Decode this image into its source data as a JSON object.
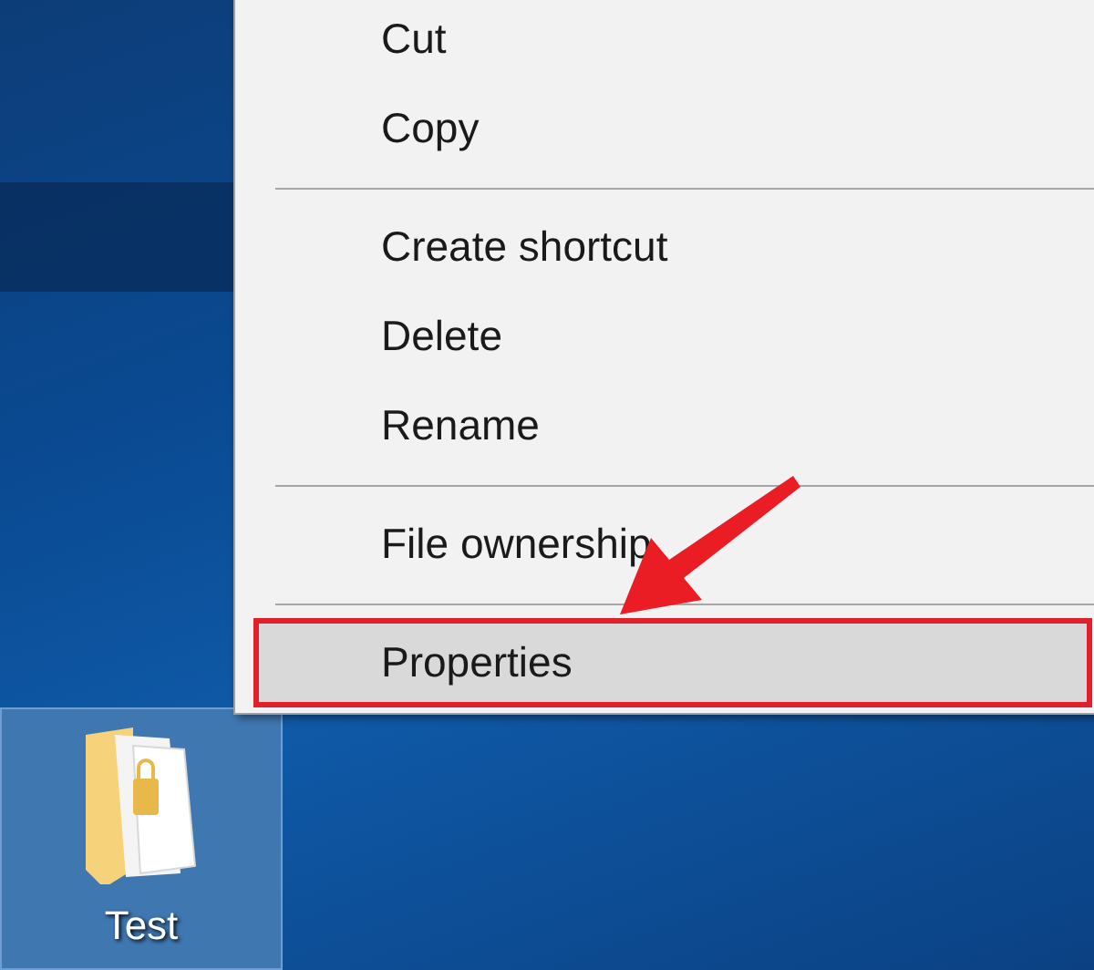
{
  "context_menu": {
    "items": [
      {
        "kind": "item",
        "label": "Cut",
        "selected": false
      },
      {
        "kind": "item",
        "label": "Copy",
        "selected": false
      },
      {
        "kind": "separator"
      },
      {
        "kind": "item",
        "label": "Create shortcut",
        "selected": false
      },
      {
        "kind": "item",
        "label": "Delete",
        "selected": false
      },
      {
        "kind": "item",
        "label": "Rename",
        "selected": false
      },
      {
        "kind": "separator"
      },
      {
        "kind": "item",
        "label": "File ownership",
        "selected": false
      },
      {
        "kind": "separator"
      },
      {
        "kind": "item",
        "label": "Properties",
        "selected": true,
        "highlighted": true
      }
    ]
  },
  "desktop_icon": {
    "label": "Test",
    "selected": true
  }
}
